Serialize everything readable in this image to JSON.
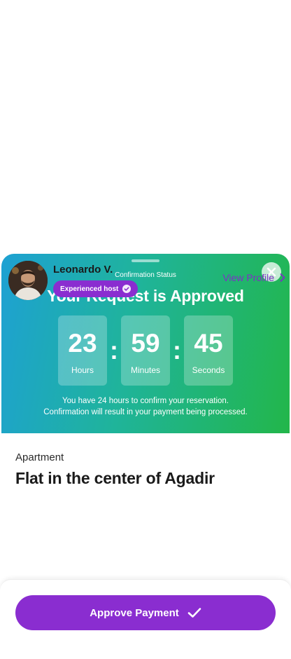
{
  "hero": {
    "status_label": "Confirmation Status",
    "title": "Your Request is Approved",
    "close_icon": "close-icon",
    "countdown": {
      "hours": "23",
      "hours_label": "Hours",
      "minutes": "59",
      "minutes_label": "Minutes",
      "seconds": "45",
      "seconds_label": "Seconds",
      "separator": ":"
    },
    "note_line1": "You have 24 hours to confirm your reservation.",
    "note_line2": "Confirmation will result in your payment being processed."
  },
  "listing": {
    "category": "Apartment",
    "title": "Flat in the center of Agadir"
  },
  "host": {
    "name": "Leonardo V.",
    "badge": "Experienced host",
    "badge_icon": "verified-check-icon",
    "view_profile": "View Profile",
    "view_profile_icon": "chevron-right-icon"
  },
  "footer": {
    "approve_label": "Approve Payment",
    "approve_icon": "checkmark-icon"
  },
  "colors": {
    "gradient_start": "#1ea1d3",
    "gradient_end": "#22b64a",
    "accent_purple": "#8a2dd0",
    "link_purple": "#7e2fc7"
  }
}
